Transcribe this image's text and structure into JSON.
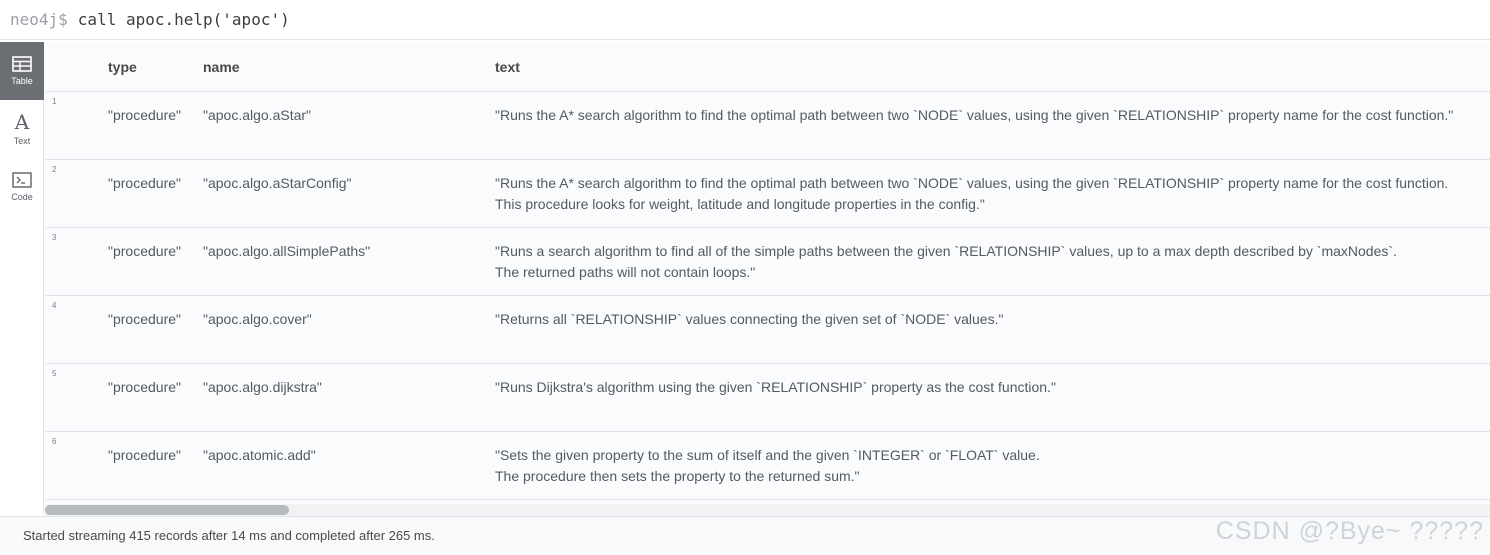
{
  "editor": {
    "prompt": "neo4j$",
    "query": "call apoc.help('apoc')"
  },
  "sidebar": {
    "items": [
      {
        "label": "Table",
        "icon": "table-icon"
      },
      {
        "label": "Text",
        "icon": "text-icon"
      },
      {
        "label": "Code",
        "icon": "code-icon"
      }
    ]
  },
  "table": {
    "columns": [
      "type",
      "name",
      "text"
    ],
    "rows": [
      {
        "num": "1",
        "type": "\"procedure\"",
        "name": "\"apoc.algo.aStar\"",
        "text": "\"Runs the A* search algorithm to find the optimal path between two `NODE` values, using the given `RELATIONSHIP` property name for the cost function.\""
      },
      {
        "num": "2",
        "type": "\"procedure\"",
        "name": "\"apoc.algo.aStarConfig\"",
        "text": "\"Runs the A* search algorithm to find the optimal path between two `NODE` values, using the given `RELATIONSHIP` property name for the cost function.\nThis procedure looks for weight, latitude and longitude properties in the config.\""
      },
      {
        "num": "3",
        "type": "\"procedure\"",
        "name": "\"apoc.algo.allSimplePaths\"",
        "text": "\"Runs a search algorithm to find all of the simple paths between the given `RELATIONSHIP` values, up to a max depth described by `maxNodes`.\nThe returned paths will not contain loops.\""
      },
      {
        "num": "4",
        "type": "\"procedure\"",
        "name": "\"apoc.algo.cover\"",
        "text": "\"Returns all `RELATIONSHIP` values connecting the given set of `NODE` values.\""
      },
      {
        "num": "5",
        "type": "\"procedure\"",
        "name": "\"apoc.algo.dijkstra\"",
        "text": "\"Runs Dijkstra's algorithm using the given `RELATIONSHIP` property as the cost function.\""
      },
      {
        "num": "6",
        "type": "\"procedure\"",
        "name": "\"apoc.atomic.add\"",
        "text": "\"Sets the given property to the sum of itself and the given `INTEGER` or `FLOAT` value.\nThe procedure then sets the property to the returned sum.\""
      }
    ]
  },
  "status": {
    "text": "Started streaming 415 records after 14 ms and completed after 265 ms."
  },
  "watermark": "CSDN @?Bye~      ?????"
}
